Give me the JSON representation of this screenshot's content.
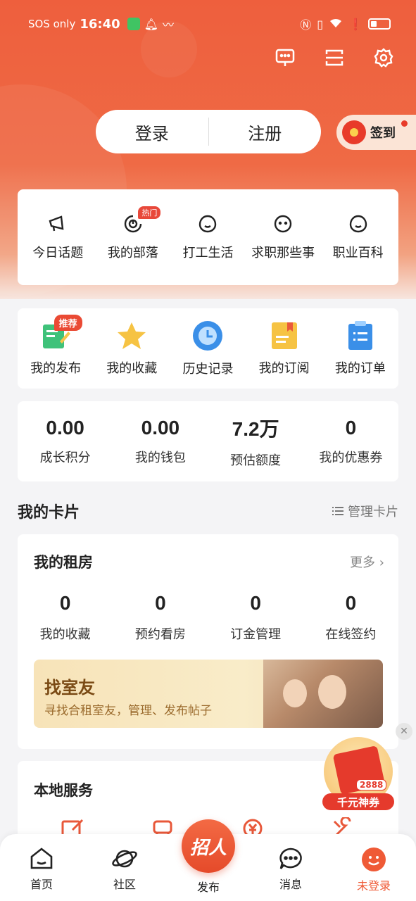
{
  "status_bar": {
    "carrier": "SOS only",
    "time": "16:40"
  },
  "header": {
    "login_label": "登录",
    "register_label": "注册",
    "checkin_label": "签到"
  },
  "topics": [
    {
      "label": "今日话题",
      "icon": "megaphone-icon"
    },
    {
      "label": "我的部落",
      "icon": "tribe-icon",
      "badge": "热门"
    },
    {
      "label": "打工生活",
      "icon": "face-icon"
    },
    {
      "label": "求职那些事",
      "icon": "face-icon"
    },
    {
      "label": "职业百科",
      "icon": "face-icon"
    }
  ],
  "tools": [
    {
      "label": "我的发布",
      "icon": "publish-icon",
      "badge": "推荐"
    },
    {
      "label": "我的收藏",
      "icon": "star-icon"
    },
    {
      "label": "历史记录",
      "icon": "clock-icon"
    },
    {
      "label": "我的订阅",
      "icon": "subscribe-icon"
    },
    {
      "label": "我的订单",
      "icon": "order-icon"
    }
  ],
  "stats": [
    {
      "value": "0.00",
      "label": "成长积分"
    },
    {
      "value": "0.00",
      "label": "我的钱包"
    },
    {
      "value": "7.2万",
      "label": "预估额度"
    },
    {
      "value": "0",
      "label": "我的优惠券"
    }
  ],
  "cards_section": {
    "title": "我的卡片",
    "manage_label": "管理卡片"
  },
  "rental": {
    "title": "我的租房",
    "more_label": "更多",
    "stats": [
      {
        "value": "0",
        "label": "我的收藏"
      },
      {
        "value": "0",
        "label": "预约看房"
      },
      {
        "value": "0",
        "label": "订金管理"
      },
      {
        "value": "0",
        "label": "在线签约"
      }
    ],
    "banner_title": "找室友",
    "banner_subtitle": "寻找合租室友，管理、发布帖子"
  },
  "local_services": {
    "title": "本地服务"
  },
  "coupon": {
    "amount": "2888",
    "label": "千元神券"
  },
  "tabbar": {
    "home": "首页",
    "community": "社区",
    "publish_button": "招人",
    "publish": "发布",
    "messages": "消息",
    "profile": "未登录"
  },
  "colors": {
    "brand": "#ef5a36",
    "hero_top": "#ee5f3d",
    "badge_red": "#e8483a"
  }
}
